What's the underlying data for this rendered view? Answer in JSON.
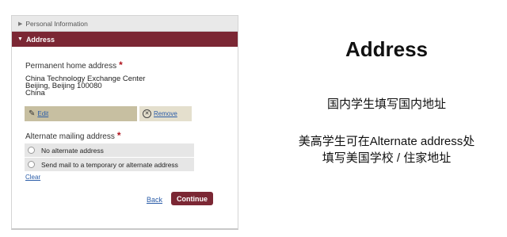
{
  "form": {
    "personal_info_label": "Personal Information",
    "address_section_label": "Address",
    "permanent_address_label": "Permanent home address",
    "required_marker": "*",
    "address_lines": [
      "China Technology Exchange Center",
      "Beijing, Beijing 100080",
      "China"
    ],
    "edit_label": "Edit",
    "remove_label": "Remove",
    "alternate_mailing_label": "Alternate mailing address",
    "options": [
      "No alternate address",
      "Send mail to a temporary or alternate address"
    ],
    "clear_label": "Clear",
    "back_label": "Back",
    "continue_label": "Continue"
  },
  "slide": {
    "title": "Address",
    "note1": "国内学生填写国内地址",
    "note2_line1": "美高学生可在Alternate address处",
    "note2_line2": "填写美国学校 / 住家地址"
  },
  "colors": {
    "accent": "#7b2734",
    "edit_bar": "#c7bfa1",
    "remove_bar": "#e4dfcd",
    "link": "#2a5ca8",
    "required": "#b0141e"
  },
  "icons": [
    "triangle-right-icon",
    "triangle-down-icon",
    "pencil-icon",
    "remove-x-icon",
    "radio-icon"
  ]
}
